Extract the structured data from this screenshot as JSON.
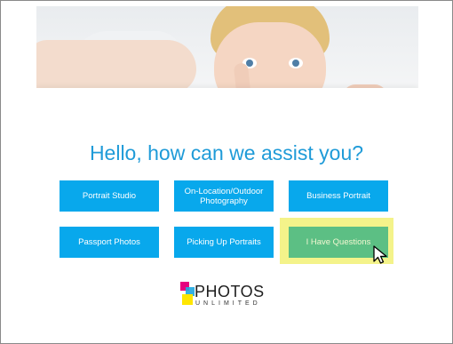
{
  "headline": "Hello, how can we assist you?",
  "buttons": [
    {
      "label": "Portrait Studio"
    },
    {
      "label": "On-Location/Outdoor Photography"
    },
    {
      "label": "Business Portrait"
    },
    {
      "label": "Passport Photos"
    },
    {
      "label": "Picking Up Portraits"
    },
    {
      "label": "I Have Questions"
    }
  ],
  "logo": {
    "word": "PHOTOS",
    "sub": "UNLIMITED"
  },
  "colors": {
    "accent": "#08a8ec",
    "headline": "#1f9bd8",
    "selected": "#5cbf84",
    "highlight": "#f4f38a"
  }
}
